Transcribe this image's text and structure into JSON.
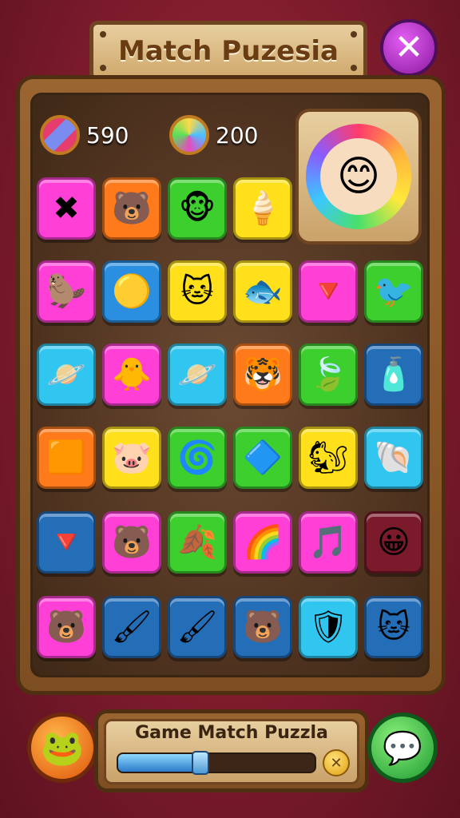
{
  "header": {
    "title": "Match Puzesia",
    "close_label": "✕"
  },
  "counters": [
    {
      "name": "coins",
      "icon": "striped-ball-icon",
      "value": "590"
    },
    {
      "name": "gems",
      "icon": "rainbow-orb-icon",
      "value": "200"
    }
  ],
  "portrait": {
    "icon": "smiling-face-icon",
    "glyph": "😊"
  },
  "tile_colors": {
    "pink": "#ff3fd6",
    "orange": "#ff7a1a",
    "green": "#3ccf2e",
    "yellow": "#ffe01a",
    "blue": "#2a8fe0",
    "cyan": "#31c6ef",
    "darkblue": "#246eb8",
    "maroon": "#7a1a2a"
  },
  "grid": [
    [
      {
        "icon": "crossed-sticks-icon",
        "glyph": "✖",
        "color": "pink"
      },
      {
        "icon": "pink-bear-icon",
        "glyph": "🐻",
        "color": "orange"
      },
      {
        "icon": "brown-monkey-icon",
        "glyph": "🐵",
        "color": "green"
      },
      {
        "icon": "blue-cone-icon",
        "glyph": "🍦",
        "color": "yellow"
      }
    ],
    [
      {
        "icon": "brown-beaver-icon",
        "glyph": "🦫",
        "color": "pink"
      },
      {
        "icon": "yellow-blob-icon",
        "glyph": "🟡",
        "color": "blue"
      },
      {
        "icon": "pink-cat-icon",
        "glyph": "🐱",
        "color": "yellow"
      },
      {
        "icon": "blue-fish-icon",
        "glyph": "🐟",
        "color": "yellow"
      },
      {
        "icon": "rainbow-cone-icon",
        "glyph": "🔻",
        "color": "pink"
      },
      {
        "icon": "purple-bird-icon",
        "glyph": "🐦",
        "color": "green"
      }
    ],
    [
      {
        "icon": "purple-planet-icon",
        "glyph": "🪐",
        "color": "cyan"
      },
      {
        "icon": "yellow-chick-icon",
        "glyph": "🐥",
        "color": "pink"
      },
      {
        "icon": "orange-planet-icon",
        "glyph": "🪐",
        "color": "cyan"
      },
      {
        "icon": "tiger-face-icon",
        "glyph": "🐯",
        "color": "orange"
      },
      {
        "icon": "rainbow-leaf-icon",
        "glyph": "🍃",
        "color": "green"
      },
      {
        "icon": "rainbow-bottle-icon",
        "glyph": "🧴",
        "color": "darkblue"
      }
    ],
    [
      {
        "icon": "orange-block-icon",
        "glyph": "🟧",
        "color": "orange"
      },
      {
        "icon": "pink-pig-icon",
        "glyph": "🐷",
        "color": "yellow"
      },
      {
        "icon": "blue-swirl-icon",
        "glyph": "🌀",
        "color": "green"
      },
      {
        "icon": "blue-top-icon",
        "glyph": "🔷",
        "color": "green"
      },
      {
        "icon": "orange-squirrel-icon",
        "glyph": "🐿",
        "color": "yellow"
      },
      {
        "icon": "spiral-shell-icon",
        "glyph": "🐚",
        "color": "cyan"
      }
    ],
    [
      {
        "icon": "rainbow-cone-icon",
        "glyph": "🔻",
        "color": "darkblue"
      },
      {
        "icon": "white-bear-icon",
        "glyph": "🐻",
        "color": "pink"
      },
      {
        "icon": "brown-leaf-icon",
        "glyph": "🍂",
        "color": "green"
      },
      {
        "icon": "rainbow-swirl-icon",
        "glyph": "🌈",
        "color": "pink"
      },
      {
        "icon": "music-note-icon",
        "glyph": "🎵",
        "color": "pink"
      },
      {
        "icon": "yellow-critter-icon",
        "glyph": "😀",
        "color": "maroon"
      }
    ],
    [
      {
        "icon": "yellow-bear-icon",
        "glyph": "🐻",
        "color": "pink"
      },
      {
        "icon": "paint-brush-icon",
        "glyph": "🖌",
        "color": "darkblue"
      },
      {
        "icon": "brown-brush-icon",
        "glyph": "🖌",
        "color": "darkblue"
      },
      {
        "icon": "yellow-bear-icon",
        "glyph": "🐻",
        "color": "darkblue"
      },
      {
        "icon": "gray-shield-icon",
        "glyph": "🛡",
        "color": "cyan"
      },
      {
        "icon": "orange-cat-icon",
        "glyph": "🐱",
        "color": "darkblue"
      }
    ]
  ],
  "footer": {
    "avatar_icon": "green-bear-icon",
    "avatar_glyph": "🐸",
    "title": "Game Match Puzzla",
    "progress": 0.42,
    "coin_glyph": "✕",
    "chat_icon": "speech-bubble-icon",
    "chat_glyph": "💬"
  }
}
